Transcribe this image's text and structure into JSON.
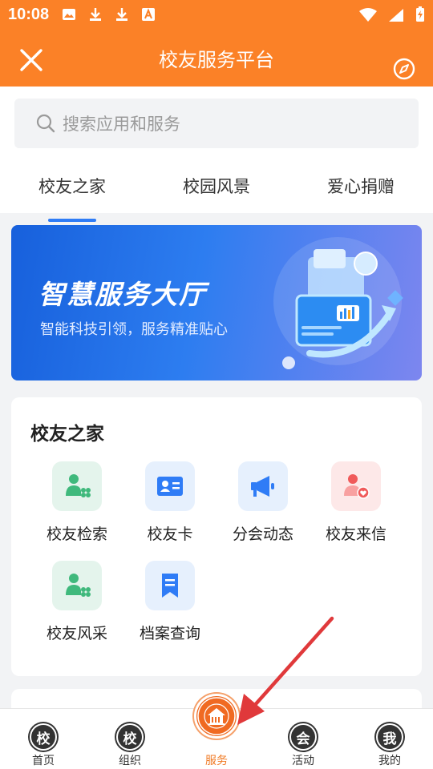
{
  "status_bar": {
    "time": "10:08"
  },
  "header": {
    "title": "校友服务平台",
    "close_icon": "close-icon",
    "compass_icon": "compass-icon"
  },
  "search": {
    "placeholder": "搜索应用和服务"
  },
  "tabs": [
    {
      "label": "校友之家",
      "active": true
    },
    {
      "label": "校园风景",
      "active": false
    },
    {
      "label": "爱心捐赠",
      "active": false
    }
  ],
  "banner": {
    "title": "智慧服务大厅",
    "subtitle": "智能科技引领，服务精准贴心"
  },
  "section": {
    "title": "校友之家",
    "items": [
      {
        "label": "校友检索",
        "icon": "alumni-search-icon",
        "color": "#3fb97c"
      },
      {
        "label": "校友卡",
        "icon": "id-card-icon",
        "color": "#2f7cf6"
      },
      {
        "label": "分会动态",
        "icon": "megaphone-icon",
        "color": "#2f7cf6"
      },
      {
        "label": "校友来信",
        "icon": "person-heart-icon",
        "color": "#f05a5a"
      },
      {
        "label": "校友风采",
        "icon": "alumni-style-icon",
        "color": "#3fb97c"
      },
      {
        "label": "档案查询",
        "icon": "bookmark-icon",
        "color": "#2f7cf6"
      }
    ]
  },
  "bottom_nav": [
    {
      "label": "首页",
      "glyph": "校",
      "active": false
    },
    {
      "label": "组织",
      "glyph": "校",
      "active": false
    },
    {
      "label": "服务",
      "glyph": "",
      "active": true
    },
    {
      "label": "活动",
      "glyph": "会",
      "active": false
    },
    {
      "label": "我的",
      "glyph": "我",
      "active": false
    }
  ],
  "colors": {
    "brand": "#fb8127",
    "accent": "#2f7cf6",
    "active_nav": "#f07a24",
    "annotation": "#e0393b"
  }
}
